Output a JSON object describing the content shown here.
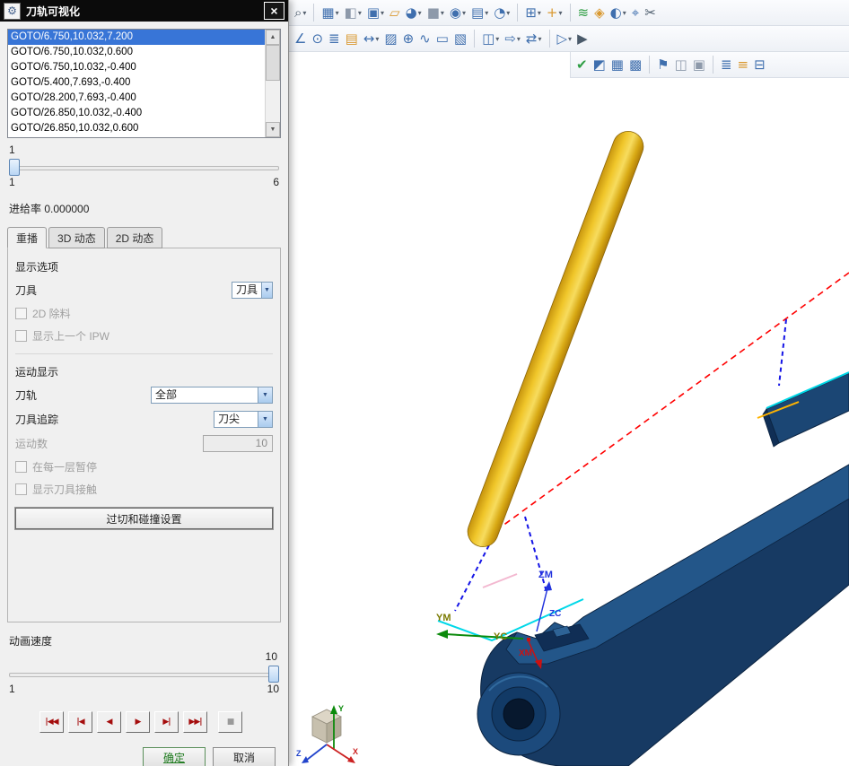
{
  "window": {
    "title": "刀轨可视化"
  },
  "icons": {
    "gear": "⚙",
    "close": "×",
    "dropdown": "▼",
    "scroll_up": "▲",
    "scroll_down": "▼"
  },
  "toolbar": {
    "row1": [
      {
        "name": "zoom",
        "glyph": "⌕",
        "color": "#4a5a6a",
        "dd": true
      },
      {
        "sep": true
      },
      {
        "name": "sketch",
        "glyph": "▦",
        "color": "#3f6fae",
        "dd": true
      },
      {
        "name": "datum-plane",
        "glyph": "◧",
        "color": "#8d99aa",
        "dd": true
      },
      {
        "name": "extrude",
        "glyph": "▣",
        "color": "#3f6fae",
        "dd": true
      },
      {
        "name": "copy-feature",
        "glyph": "▱",
        "color": "#d9982f"
      },
      {
        "name": "revolve",
        "glyph": "◕",
        "color": "#3f6fae",
        "dd": true
      },
      {
        "name": "block",
        "glyph": "■",
        "color": "#8d99aa",
        "dd": true
      },
      {
        "name": "unite",
        "glyph": "◉",
        "color": "#3f6fae",
        "dd": true
      },
      {
        "name": "pattern-feature",
        "glyph": "▤",
        "color": "#3f6fae",
        "dd": true
      },
      {
        "name": "edge-blend",
        "glyph": "◔",
        "color": "#3f6fae",
        "dd": true
      },
      {
        "sep": true
      },
      {
        "name": "add-component",
        "glyph": "⊞",
        "color": "#3f6fae",
        "dd": true
      },
      {
        "name": "move-component",
        "glyph": "+",
        "color": "#d9982f",
        "dd": true
      },
      {
        "sep": true
      },
      {
        "name": "wave-link",
        "glyph": "≋",
        "color": "#2f9e44"
      },
      {
        "name": "edit-object-display",
        "glyph": "◈",
        "color": "#d9982f"
      },
      {
        "name": "show-hide",
        "glyph": "◐",
        "color": "#3f6fae",
        "dd": true
      },
      {
        "name": "datum-csys",
        "glyph": "⌖",
        "color": "#3f6fae"
      },
      {
        "name": "trim-body",
        "glyph": "✂",
        "color": "#4a5a6a"
      }
    ],
    "row2": [
      {
        "name": "snap-angle",
        "glyph": "∠",
        "color": "#3f6fae"
      },
      {
        "name": "point-on-curve",
        "glyph": "⊙",
        "color": "#3f6fae"
      },
      {
        "name": "list",
        "glyph": "≣",
        "color": "#3f6fae"
      },
      {
        "name": "information",
        "glyph": "▤",
        "color": "#d9982f"
      },
      {
        "name": "measure-distance",
        "glyph": "↔",
        "color": "#3f6fae",
        "dd": true
      },
      {
        "name": "crosshatch",
        "glyph": "▨",
        "color": "#3f6fae"
      },
      {
        "name": "target-point",
        "glyph": "⊕",
        "color": "#3f6fae"
      },
      {
        "name": "spline",
        "glyph": "∿",
        "color": "#3f6fae"
      },
      {
        "name": "rectangle",
        "glyph": "▭",
        "color": "#3f6fae"
      },
      {
        "name": "raster-image",
        "glyph": "▧",
        "color": "#3f6fae"
      },
      {
        "sep": true
      },
      {
        "name": "new-window",
        "glyph": "◫",
        "color": "#3f6fae",
        "dd": true
      },
      {
        "name": "flow-export",
        "glyph": "⇨",
        "color": "#3f6fae",
        "dd": true
      },
      {
        "name": "flow-branch",
        "glyph": "⇄",
        "color": "#3f6fae",
        "dd": true
      },
      {
        "sep": true
      },
      {
        "name": "flow-run",
        "glyph": "▷",
        "color": "#3f6fae",
        "dd": true
      },
      {
        "name": "play-animation",
        "glyph": "▶",
        "color": "#4a5a6a"
      }
    ],
    "row3": [
      {
        "name": "verify",
        "glyph": "✔",
        "color": "#2f9e44"
      },
      {
        "name": "show-wcs",
        "glyph": "◩",
        "color": "#3f6fae"
      },
      {
        "name": "pattern-geometry",
        "glyph": "▦",
        "color": "#3f6fae"
      },
      {
        "name": "object-group",
        "glyph": "▩",
        "color": "#3f6fae"
      },
      {
        "sep": true
      },
      {
        "name": "flag",
        "glyph": "⚑",
        "color": "#3f6fae"
      },
      {
        "name": "window-split",
        "glyph": "◫",
        "color": "#8d99aa"
      },
      {
        "name": "snapshot",
        "glyph": "▣",
        "color": "#8d99aa"
      },
      {
        "sep": true
      },
      {
        "name": "list-view",
        "glyph": "≣",
        "color": "#3f6fae"
      },
      {
        "name": "detail-view",
        "glyph": "≡",
        "color": "#d9982f"
      },
      {
        "name": "tree-view",
        "glyph": "⊟",
        "color": "#3f6fae"
      }
    ]
  },
  "dialog": {
    "goto_list": [
      "GOTO/6.750,10.032,7.200",
      "GOTO/6.750,10.032,0.600",
      "GOTO/6.750,10.032,-0.400",
      "GOTO/5.400,7.693,-0.400",
      "GOTO/28.200,7.693,-0.400",
      "GOTO/26.850,10.032,-0.400",
      "GOTO/26.850,10.032,0.600"
    ],
    "selected_index": 0,
    "progress": {
      "current_label": "1",
      "min": "1",
      "max": "6"
    },
    "feed_rate": "进给率 0.000000",
    "tabs": [
      {
        "label": "重播"
      },
      {
        "label": "3D 动态"
      },
      {
        "label": "2D 动态"
      }
    ],
    "groups": {
      "display_options": "显示选项",
      "tool_label": "刀具",
      "tool_value": "刀具",
      "cb_2d": "2D 除料",
      "cb_ipw": "显示上一个 IPW",
      "motion_display": "运动显示",
      "path_label": "刀轨",
      "path_value": "全部",
      "trace_label": "刀具追踪",
      "trace_value": "刀尖",
      "count_label": "运动数",
      "count_value": "10",
      "cb_pause": "在每一层暂停",
      "cb_contact": "显示刀具接触",
      "gouge_button": "过切和碰撞设置"
    },
    "anim_speed_label": "动画速度",
    "speed": {
      "current_label": "10",
      "min": "1",
      "max": "10"
    },
    "playback": [
      {
        "name": "go-to-start",
        "glyph": "|◀◀",
        "color": "#a50d0d"
      },
      {
        "name": "step-back",
        "glyph": "|◀",
        "color": "#a50d0d"
      },
      {
        "name": "play-backward",
        "glyph": "◀",
        "color": "#a50d0d"
      },
      {
        "name": "play-forward",
        "glyph": "▶",
        "color": "#a50d0d"
      },
      {
        "name": "step-forward",
        "glyph": "▶|",
        "color": "#a50d0d"
      },
      {
        "name": "go-to-end",
        "glyph": "▶▶|",
        "color": "#a50d0d"
      },
      {
        "name": "stop",
        "glyph": "■",
        "color": "#9a9a9a"
      }
    ],
    "ok": "确定",
    "cancel": "取消"
  },
  "viewport": {
    "labels": {
      "zm": "ZM",
      "zc": "ZC",
      "ym": "YM",
      "yc": "YC",
      "xm": "XM",
      "triad_x": "X",
      "triad_y": "Y",
      "triad_z": "Z"
    }
  }
}
